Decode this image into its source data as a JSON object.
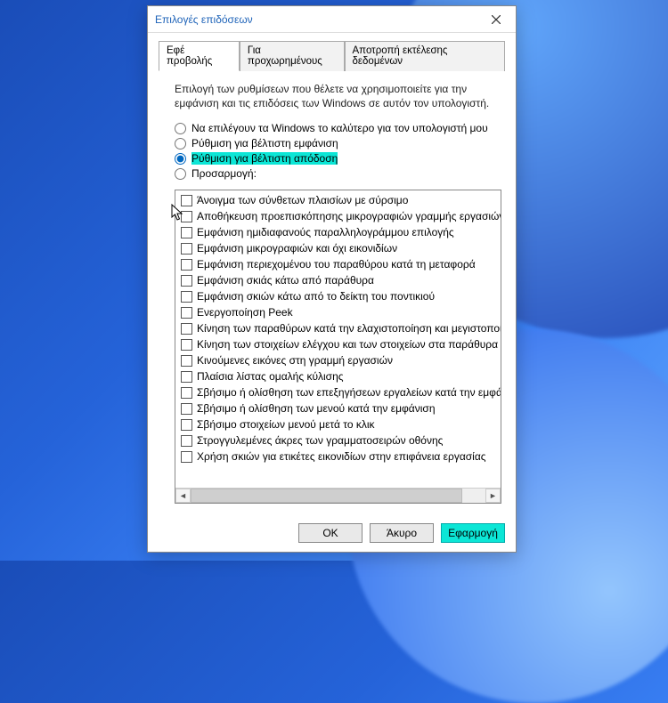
{
  "window": {
    "title": "Επιλογές επιδόσεων"
  },
  "tabs": {
    "visualEffects": "Εφέ προβολής",
    "advanced": "Για προχωρημένους",
    "dep": "Αποτροπή εκτέλεσης δεδομένων"
  },
  "description": "Επιλογή των ρυθμίσεων που θέλετε να χρησιμοποιείτε για την εμφάνιση και τις επιδόσεις των Windows σε αυτόν τον υπολογιστή.",
  "radios": {
    "letWindows": "Να επιλέγουν τα Windows το καλύτερο για τον υπολογιστή μου",
    "bestAppearance": "Ρύθμιση για βέλτιστη εμφάνιση",
    "bestPerformance": "Ρύθμιση για βέλτιστη απόδοση",
    "custom": "Προσαρμογή:"
  },
  "checkboxes": [
    "Άνοιγμα των σύνθετων πλαισίων με σύρσιμο",
    "Αποθήκευση προεπισκόπησης μικρογραφιών γραμμής εργασιών",
    "Εμφάνιση ημιδιαφανούς παραλληλογράμμου επιλογής",
    "Εμφάνιση μικρογραφιών και όχι εικονιδίων",
    "Εμφάνιση περιεχομένου του παραθύρου κατά τη μεταφορά",
    "Εμφάνιση σκιάς κάτω από παράθυρα",
    "Εμφάνιση σκιών κάτω από το δείκτη του ποντικιού",
    "Ενεργοποίηση Peek",
    "Κίνηση των παραθύρων κατά την ελαχιστοποίηση και μεγιστοποίηση",
    "Κίνηση των στοιχείων ελέγχου και των στοιχείων στα παράθυρα",
    "Κινούμενες εικόνες στη γραμμή εργασιών",
    "Πλαίσια λίστας ομαλής κύλισης",
    "Σβήσιμο ή ολίσθηση των επεξηγήσεων εργαλείων κατά την εμφάνιση",
    "Σβήσιμο ή ολίσθηση των μενού κατά την εμφάνιση",
    "Σβήσιμο στοιχείων μενού μετά το κλικ",
    "Στρογγυλεμένες άκρες των γραμματοσειρών οθόνης",
    "Χρήση σκιών για ετικέτες εικονιδίων στην επιφάνεια εργασίας"
  ],
  "buttons": {
    "ok": "OK",
    "cancel": "Άκυρο",
    "apply": "Εφαρμογή"
  }
}
